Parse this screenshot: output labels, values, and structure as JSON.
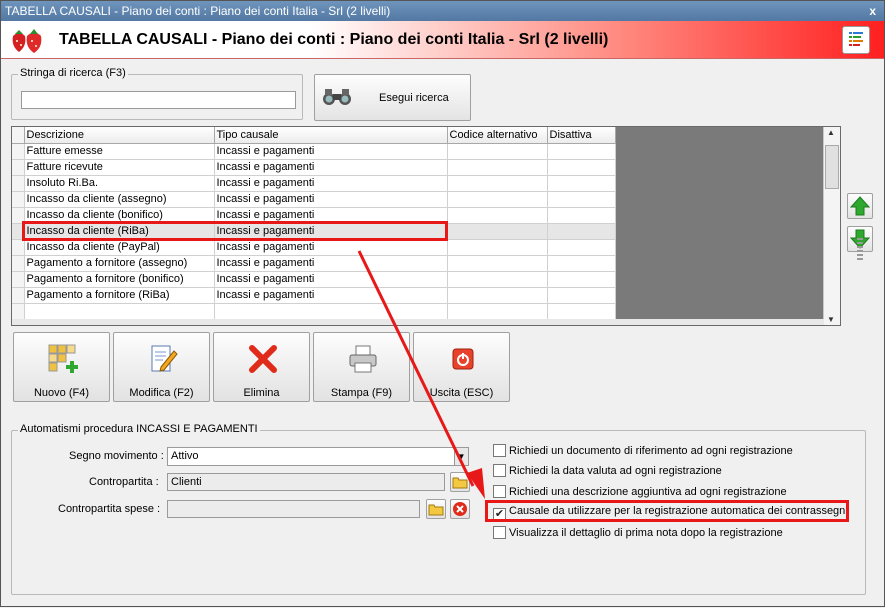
{
  "window": {
    "title": "TABELLA CAUSALI - Piano dei conti : Piano dei conti Italia - Srl (2 livelli)",
    "header_title": "TABELLA CAUSALI - Piano dei conti : Piano dei conti Italia - Srl (2 livelli)"
  },
  "search": {
    "legend": "Stringa di ricerca (F3)",
    "value": "",
    "button_label": "Esegui ricerca"
  },
  "grid": {
    "columns": [
      "Descrizione",
      "Tipo causale",
      "Codice alternativo",
      "Disattiva"
    ],
    "rows": [
      {
        "descrizione": "Fatture emesse",
        "tipo": "Incassi e pagamenti"
      },
      {
        "descrizione": "Fatture ricevute",
        "tipo": "Incassi e pagamenti"
      },
      {
        "descrizione": "Insoluto Ri.Ba.",
        "tipo": "Incassi e pagamenti"
      },
      {
        "descrizione": "Incasso da cliente (assegno)",
        "tipo": "Incassi e pagamenti"
      },
      {
        "descrizione": "Incasso da cliente (bonifico)",
        "tipo": "Incassi e pagamenti"
      },
      {
        "descrizione": "Incasso da cliente (RiBa)",
        "tipo": "Incassi e pagamenti"
      },
      {
        "descrizione": "Incasso da cliente (PayPal)",
        "tipo": "Incassi e pagamenti"
      },
      {
        "descrizione": "Pagamento a fornitore (assegno)",
        "tipo": "Incassi e pagamenti"
      },
      {
        "descrizione": "Pagamento a fornitore (bonifico)",
        "tipo": "Incassi e pagamenti"
      },
      {
        "descrizione": "Pagamento a fornitore (RiBa)",
        "tipo": "Incassi e pagamenti"
      }
    ],
    "selected_row": 5
  },
  "toolbar": {
    "nuovo": "Nuovo (F4)",
    "modifica": "Modifica (F2)",
    "elimina": "Elimina",
    "stampa": "Stampa (F9)",
    "uscita": "Uscita (ESC)"
  },
  "auto": {
    "legend": "Automatismi procedura INCASSI E PAGAMENTI",
    "segno_label": "Segno movimento :",
    "segno_value": "Attivo",
    "contropartita_label": "Contropartita :",
    "contropartita_value": "Clienti",
    "spese_label": "Contropartita spese :",
    "spese_value": "",
    "checks": [
      {
        "label": "Richiedi un documento di riferimento ad ogni registrazione",
        "checked": false
      },
      {
        "label": "Richiedi la data valuta ad ogni registrazione",
        "checked": false
      },
      {
        "label": "Richiedi una descrizione aggiuntiva ad ogni registrazione",
        "checked": false
      },
      {
        "label": "Causale da utilizzare per la registrazione automatica dei contrassegni",
        "checked": true
      },
      {
        "label": "Visualizza il dettaglio di prima nota dopo la registrazione",
        "checked": false
      }
    ],
    "check_mark": "✔"
  },
  "colors": {
    "highlight": "#e81818",
    "arrow": "#e81818",
    "green_arrow": "#2fa82f"
  }
}
